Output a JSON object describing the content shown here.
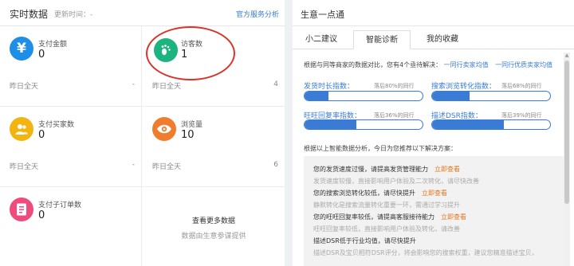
{
  "left": {
    "title": "实时数据",
    "updated_label": "更新时间：-",
    "official_link": "官方服务分析",
    "metrics": [
      {
        "label": "支付金额",
        "value": "0",
        "foot": "昨日全天",
        "foot_value": "-",
        "color": "#1e8ee6",
        "icon": "yen-icon",
        "glyph": "¥"
      },
      {
        "label": "访客数",
        "value": "1",
        "foot": "昨日全天",
        "foot_value": "4",
        "color": "#1bb37e",
        "icon": "footprint-icon",
        "glyph": ""
      },
      {
        "label": "支付买家数",
        "value": "0",
        "foot": "昨日全天",
        "foot_value": "-",
        "color": "#f3b411",
        "icon": "buyer-icon",
        "glyph": ""
      },
      {
        "label": "浏览量",
        "value": "10",
        "foot": "昨日全天",
        "foot_value": "6",
        "color": "#f07d2e",
        "icon": "eye-icon",
        "glyph": ""
      },
      {
        "label": "支付子订单数",
        "value": "0",
        "foot": "",
        "foot_value": "",
        "color": "#ef4b7c",
        "icon": "order-icon",
        "glyph": ""
      }
    ],
    "more": {
      "title": "查看更多数据",
      "subtitle": "数据由生意参谋提供"
    }
  },
  "right": {
    "title": "生意一点通",
    "tabs": [
      "小二建议",
      "智能诊断",
      "我的收藏"
    ],
    "active_tab": "智能诊断",
    "intro": "根据与同等商家的数据对比，您有4个亟待解决：",
    "intro_link1": "一同行卖家均值",
    "intro_link2": "一同行优质卖家均值",
    "indices": [
      {
        "label": "发货时长指数：",
        "beat": "落后80%的同行",
        "fill": 0.2
      },
      {
        "label": "搜索浏览转化指数：",
        "beat": "落后68%的同行",
        "fill": 0.32
      },
      {
        "label": "旺旺回复率指数：",
        "beat": "落后36%的同行",
        "fill": 0.44
      },
      {
        "label": "描述DSR指数：",
        "beat": "落后39%的同行",
        "fill": 0.61
      }
    ],
    "solution_intro": "根据以上智能数据分析，今日为您推荐以下解决方案：",
    "view_label": "立即查看",
    "solutions": [
      {
        "head": "您的发货速度过慢，请提高发货管理能力",
        "desc": "发货速度较慢，直接影响用户体验及二次转化，请尽快改善",
        "view": true
      },
      {
        "head": "您的搜索浏览转化较低，请尽快提升",
        "desc": "静默转化是搜索流量转化重要一环，需通过学习提升",
        "view": true
      },
      {
        "head": "您的旺旺回复率较低，请提高客服接待能力",
        "desc": "旺旺回复率较低，直接影响用户体验及转化，请改善",
        "view": true
      },
      {
        "head": "描述DSR低于行业均值，请尽快提升",
        "desc": "描述DSR及宝贝相符DSR评分，将会影响您的搜索权重，建议您精准描述宝贝，",
        "view": false
      }
    ]
  }
}
